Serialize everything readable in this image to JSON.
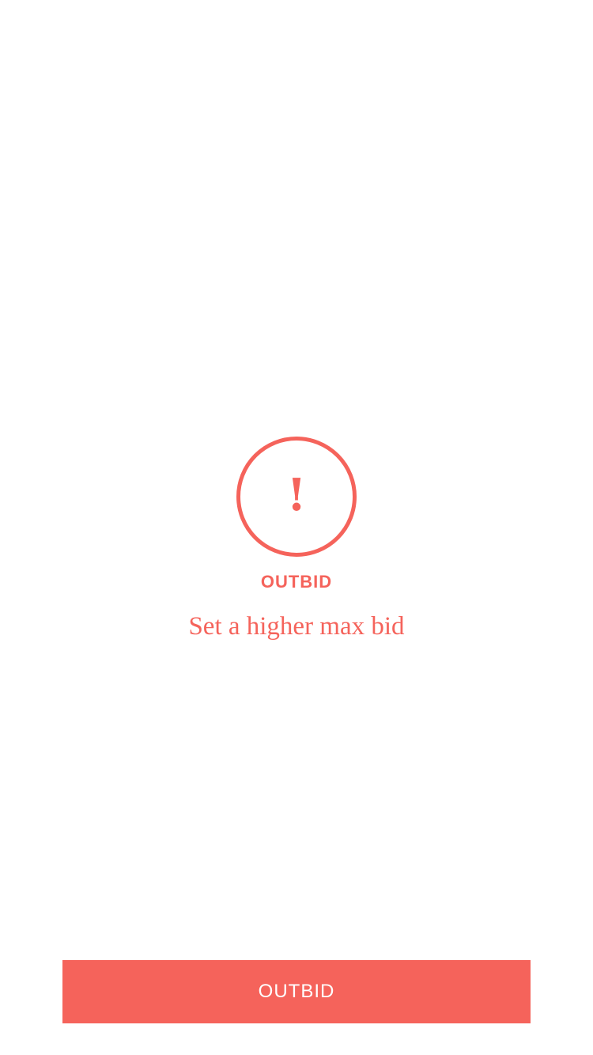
{
  "theme": {
    "accent_color": "#f5635b",
    "background_color": "#ffffff",
    "button_text_color": "#ffffff"
  },
  "status": {
    "icon": "exclamation-circle-icon",
    "icon_glyph": "!",
    "title": "OUTBID",
    "message": "Set a higher max bid"
  },
  "action_button": {
    "label": "OUTBID"
  }
}
